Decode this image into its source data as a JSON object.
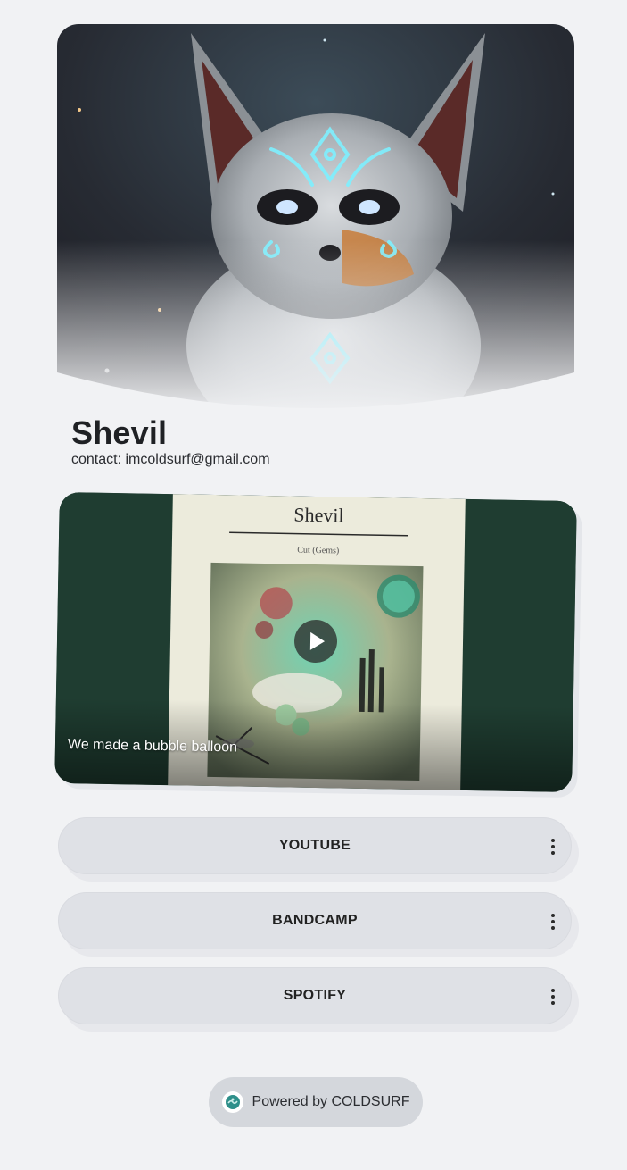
{
  "profile": {
    "name": "Shevil",
    "contact": "contact: imcoldsurf@gmail.com"
  },
  "featured_video": {
    "album_title": "Shevil",
    "album_subtitle": "Cut (Gems)",
    "caption": "We made a bubble balloon"
  },
  "links": [
    {
      "label": "YOUTUBE"
    },
    {
      "label": "BANDCAMP"
    },
    {
      "label": "SPOTIFY"
    }
  ],
  "footer": {
    "powered_by": "Powered by COLDSURF"
  },
  "colors": {
    "background": "#f1f2f4",
    "link_button": "#dfe1e6",
    "video_backdrop": "#1f3d31",
    "album_paper": "#ecebdc"
  }
}
